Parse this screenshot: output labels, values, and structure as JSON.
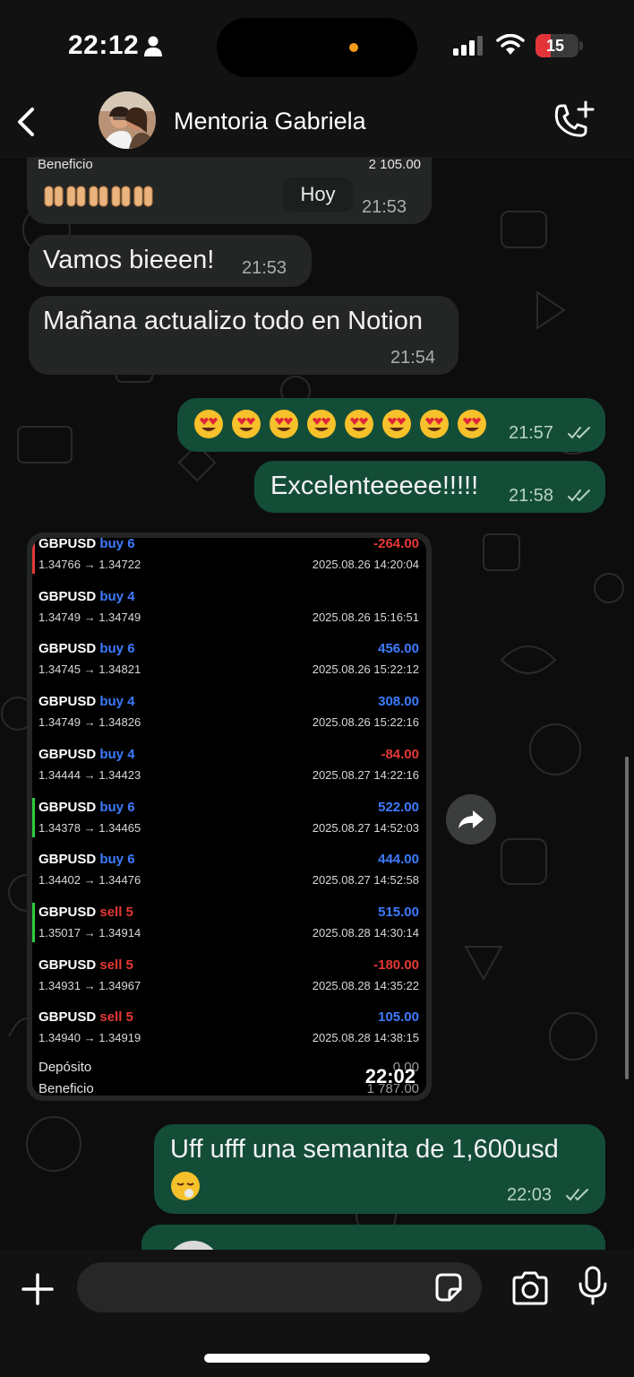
{
  "status_bar": {
    "time": "22:12",
    "battery": "15",
    "battery_level": 0.15
  },
  "header": {
    "contact_name": "Mentoria Gabriela",
    "icons": {
      "back": "chevron-left-icon",
      "call": "phone-add-icon"
    }
  },
  "chat": {
    "top_image": {
      "label": "Beneficio",
      "value": "2 105.00",
      "emoji": "raising-hands-emoji",
      "time": "21:53"
    },
    "date_pill": "Hoy",
    "messages": [
      {
        "direction": "in",
        "text": "Vamos bieeen!",
        "time": "21:53"
      },
      {
        "direction": "in",
        "text": "Mañana actualizo todo en Notion",
        "time": "21:54"
      },
      {
        "direction": "out",
        "emoji": "heart-eyes-emoji",
        "emoji_count": 8,
        "time": "21:57",
        "status": "read"
      },
      {
        "direction": "out",
        "text": "Excelenteeeee!!!!!",
        "time": "21:58",
        "status": "read"
      },
      {
        "direction": "out",
        "text": "Uff ufff una semanita de 1,600usd",
        "emoji": "face-exhaling-emoji",
        "time": "22:03",
        "status": "read"
      }
    ],
    "trade_image": {
      "time": "22:02",
      "trades": [
        {
          "symbol": "GBPUSD",
          "side": "buy 6",
          "prices": "1.34766 → 1.34722",
          "profit": "-264.00",
          "timestamp": "2025.08.26 14:20:04",
          "profit_color": "#e53935",
          "marker_color": "#e53935"
        },
        {
          "symbol": "GBPUSD",
          "side": "buy 4",
          "prices": "1.34749 → 1.34749",
          "profit": "",
          "timestamp": "2025.08.26 15:16:51",
          "profit_color": "#3d7bff",
          "marker_color": ""
        },
        {
          "symbol": "GBPUSD",
          "side": "buy 6",
          "prices": "1.34745 → 1.34821",
          "profit": "456.00",
          "timestamp": "2025.08.26 15:22:12",
          "profit_color": "#3d7bff",
          "marker_color": ""
        },
        {
          "symbol": "GBPUSD",
          "side": "buy 4",
          "prices": "1.34749 → 1.34826",
          "profit": "308.00",
          "timestamp": "2025.08.26 15:22:16",
          "profit_color": "#3d7bff",
          "marker_color": ""
        },
        {
          "symbol": "GBPUSD",
          "side": "buy 4",
          "prices": "1.34444 → 1.34423",
          "profit": "-84.00",
          "timestamp": "2025.08.27 14:22:16",
          "profit_color": "#e53935",
          "marker_color": ""
        },
        {
          "symbol": "GBPUSD",
          "side": "buy 6",
          "prices": "1.34378 → 1.34465",
          "profit": "522.00",
          "timestamp": "2025.08.27 14:52:03",
          "profit_color": "#3d7bff",
          "marker_color": "#2ecc40"
        },
        {
          "symbol": "GBPUSD",
          "side": "buy 6",
          "prices": "1.34402 → 1.34476",
          "profit": "444.00",
          "timestamp": "2025.08.27 14:52:58",
          "profit_color": "#3d7bff",
          "marker_color": ""
        },
        {
          "symbol": "GBPUSD",
          "side": "sell 5",
          "prices": "1.35017 → 1.34914",
          "profit": "515.00",
          "timestamp": "2025.08.28 14:30:14",
          "profit_color": "#3d7bff",
          "marker_color": "#2ecc40"
        },
        {
          "symbol": "GBPUSD",
          "side": "sell 5",
          "prices": "1.34931 → 1.34967",
          "profit": "-180.00",
          "timestamp": "2025.08.28 14:35:22",
          "profit_color": "#e53935",
          "marker_color": ""
        },
        {
          "symbol": "GBPUSD",
          "side": "sell 5",
          "prices": "1.34940 → 1.34919",
          "profit": "105.00",
          "timestamp": "2025.08.28 14:38:15",
          "profit_color": "#3d7bff",
          "marker_color": ""
        }
      ],
      "summary": [
        {
          "label": "Depósito",
          "value": "0.00"
        },
        {
          "label": "Beneficio",
          "value": "1 787.00"
        }
      ]
    }
  },
  "input_bar": {
    "placeholder": "",
    "icons": {
      "plus": "plus-icon",
      "sticker": "sticker-icon",
      "camera": "camera-icon",
      "mic": "microphone-icon"
    }
  },
  "colors": {
    "incoming_bubble": "#242626",
    "outgoing_bubble": "#144d37",
    "read_ticks": "#b7d2c6",
    "buy_sell_side": "#3d7bff",
    "sell_side": "#e53935"
  }
}
